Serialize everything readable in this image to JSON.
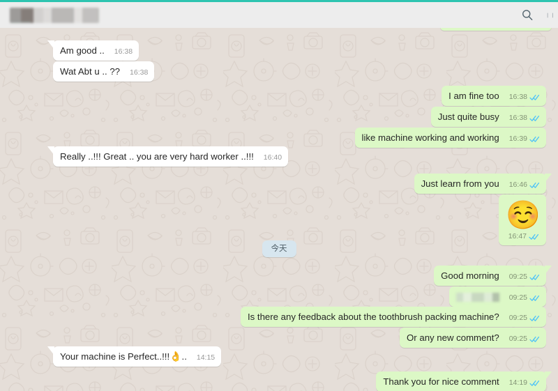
{
  "window": {
    "app": "WhatsApp",
    "accent_color": "#2ec4b0",
    "header_bg": "#ededed",
    "chat_bg": "#e5ded8",
    "incoming_bubble_color": "#ffffff",
    "outgoing_bubble_color": "#dcf8c6",
    "tick_color": "#4fc3f7",
    "date_pill_color": "#d7e6ef"
  },
  "header": {
    "contact_name": "",
    "contact_name_redacted": true,
    "search_icon": "search-icon",
    "menu_icon": "overflow-menu-icon"
  },
  "date_divider": {
    "label": "今天"
  },
  "messages": [
    {
      "id": "m1",
      "direction": "incoming",
      "text": "Am good ..",
      "time": "16:38",
      "ticks": false,
      "tail": true
    },
    {
      "id": "m2",
      "direction": "incoming",
      "text": "Wat Abt u .. ??",
      "time": "16:38",
      "ticks": false,
      "tail": false
    },
    {
      "id": "m3",
      "direction": "outgoing",
      "text": "I am fine too",
      "time": "16:38",
      "ticks": true,
      "tail": false
    },
    {
      "id": "m4",
      "direction": "outgoing",
      "text": "Just quite busy",
      "time": "16:38",
      "ticks": true,
      "tail": false
    },
    {
      "id": "m5",
      "direction": "outgoing",
      "text": "like machine working and working",
      "time": "16:39",
      "ticks": true,
      "tail": false
    },
    {
      "id": "m6",
      "direction": "incoming",
      "text": "Really ..!!! Great .. you are very hard worker ..!!!",
      "time": "16:40",
      "ticks": false,
      "tail": true
    },
    {
      "id": "m7",
      "direction": "outgoing",
      "text": "Just learn from you",
      "time": "16:46",
      "ticks": true,
      "tail": true
    },
    {
      "id": "m8",
      "direction": "outgoing",
      "emoji": "☺️",
      "emoji_name": "relaxed-smiling-face-emoji",
      "text": "",
      "time": "16:47",
      "ticks": true,
      "tail": false
    },
    {
      "id": "m9",
      "direction": "outgoing",
      "text": "Good morning",
      "time": "09:25",
      "ticks": true,
      "tail": true
    },
    {
      "id": "m10",
      "direction": "outgoing",
      "text": "",
      "redacted": true,
      "time": "09:25",
      "ticks": true,
      "tail": false
    },
    {
      "id": "m11",
      "direction": "outgoing",
      "text": "Is there any feedback about the toothbrush packing machine?",
      "time": "09:25",
      "ticks": true,
      "tail": false
    },
    {
      "id": "m12",
      "direction": "outgoing",
      "text": "Or any new comment?",
      "time": "09:25",
      "ticks": true,
      "tail": false
    },
    {
      "id": "m13",
      "direction": "incoming",
      "text": "Your machine is Perfect..!!! ",
      "emoji_inline": "👌",
      "emoji_inline_name": "ok-hand-emoji",
      "text_after": "..",
      "time": "14:15",
      "ticks": false,
      "tail": true
    },
    {
      "id": "m14",
      "direction": "outgoing",
      "text": "Thank you for nice comment",
      "time": "14:19",
      "ticks": true,
      "tail": true
    }
  ]
}
